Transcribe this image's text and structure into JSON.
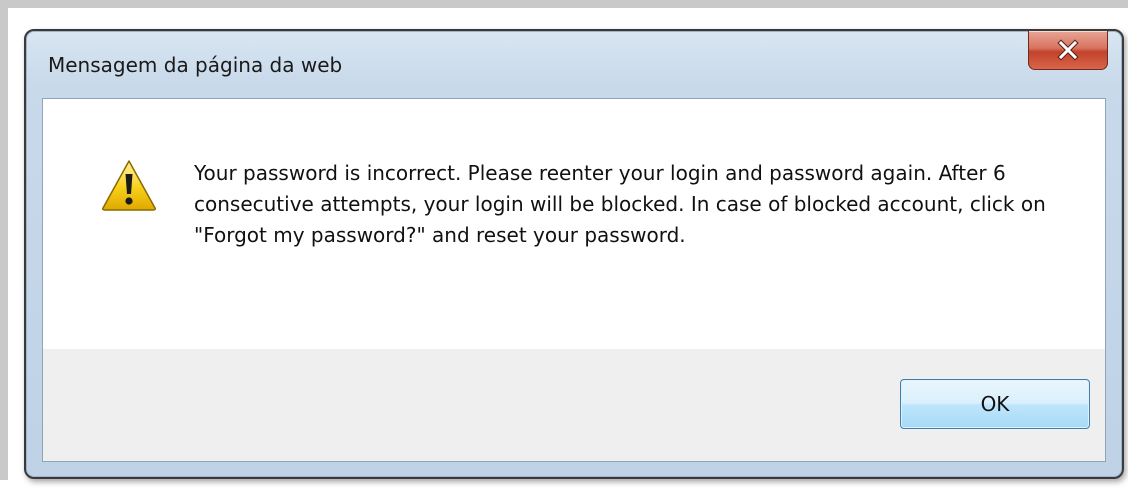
{
  "dialog": {
    "title": "Mensagem da página da web",
    "close_icon": "close-x-icon",
    "warning_icon": "warning-triangle-icon",
    "message": "Your password is incorrect. Please reenter your login and password again. After 6 consecutive attempts, your login will be blocked. In case of blocked account, click on \"Forgot my password?\" and reset your password.",
    "ok_label": "OK"
  },
  "colors": {
    "title_bar": "#c8d9ea",
    "close_button": "#c2432c",
    "ok_button_border": "#3c7fb1",
    "button_area": "#efefef",
    "warning_yellow": "#f5c400"
  }
}
